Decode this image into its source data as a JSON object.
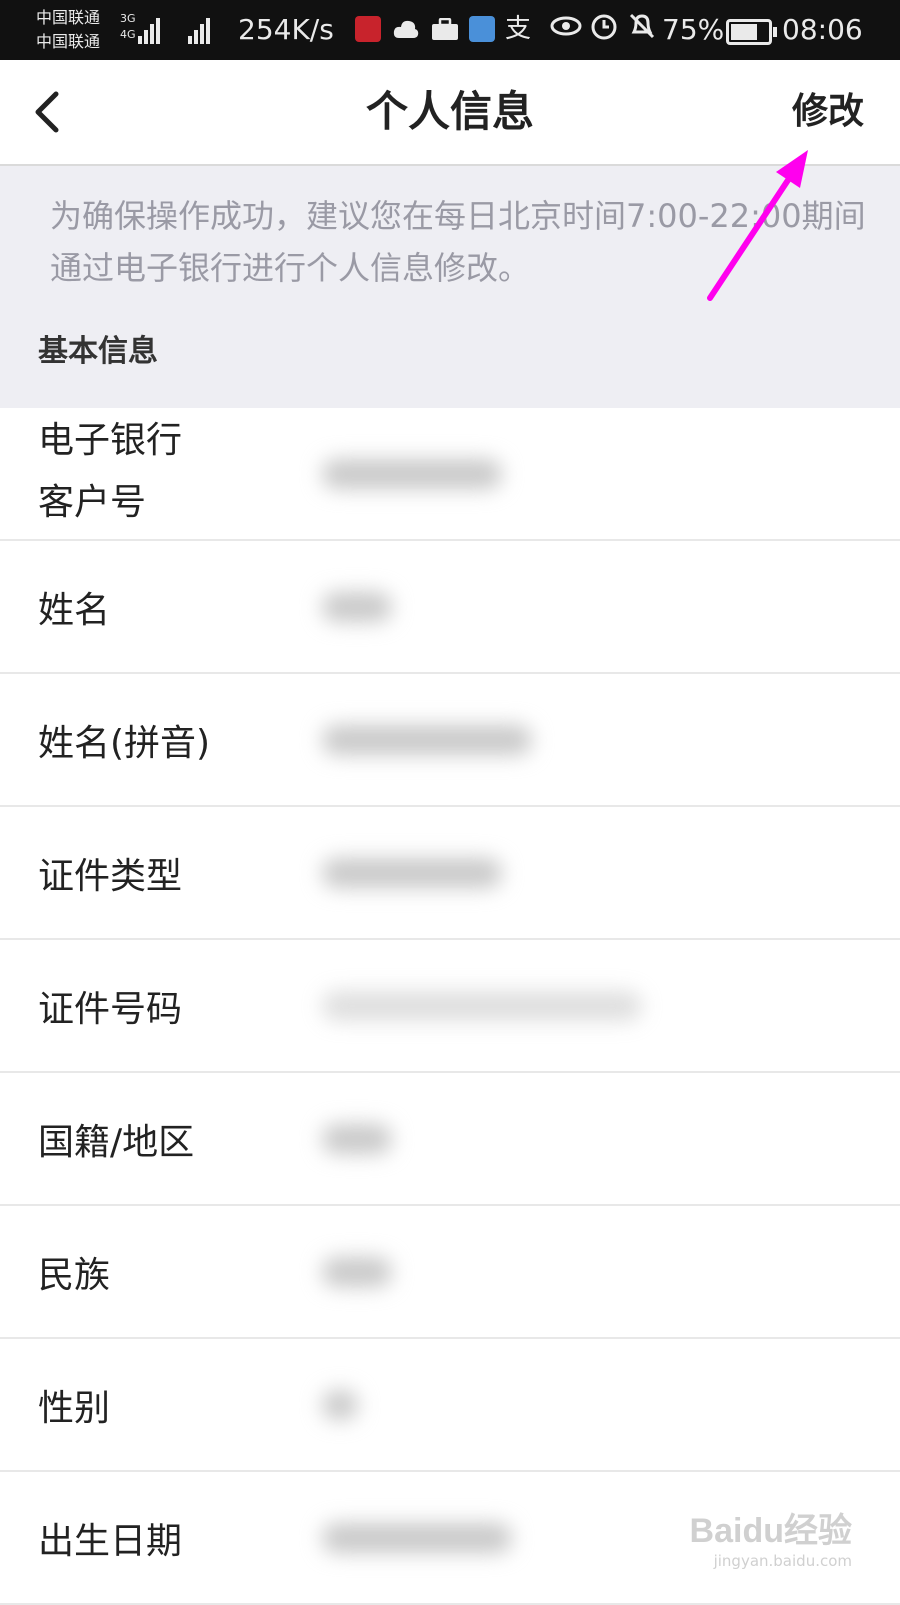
{
  "status_bar": {
    "carrier_1": "中国联通",
    "carrier_2": "中国联通",
    "net_tag_1": "3G",
    "net_tag_2": "4G",
    "speed": "254K/s",
    "battery": "75%",
    "time": "08:06"
  },
  "header": {
    "title": "个人信息",
    "edit_label": "修改"
  },
  "notice": {
    "text": "为确保操作成功，建议您在每日北京时间7:00-22:00期间通过电子银行进行个人信息修改。"
  },
  "section": {
    "title": "基本信息"
  },
  "rows": [
    {
      "label_line1": "电子银行",
      "label_line2": "客户号"
    },
    {
      "label": "姓名"
    },
    {
      "label": "姓名(拼音)"
    },
    {
      "label": "证件类型"
    },
    {
      "label": "证件号码"
    },
    {
      "label": "国籍/地区"
    },
    {
      "label": "民族"
    },
    {
      "label": "性别"
    },
    {
      "label": "出生日期"
    }
  ],
  "watermark": {
    "logo": "Baidu经验",
    "url": "jingyan.baidu.com"
  },
  "colors": {
    "annotation_arrow": "#ff00ee",
    "notice_bg": "#eeeef3",
    "notice_text": "#9a9aa5"
  }
}
